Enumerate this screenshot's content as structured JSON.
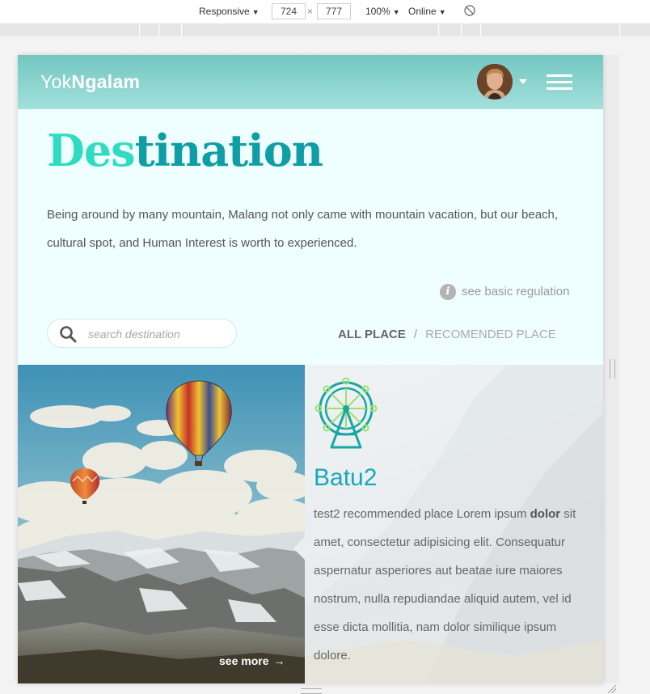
{
  "devtools": {
    "device": "Responsive",
    "width": "724",
    "height": "777",
    "zoom": "100%",
    "network": "Online",
    "times_sign": "×"
  },
  "header": {
    "logo_light": "Yok",
    "logo_bold": "Ngalam"
  },
  "intro": {
    "title_part1": "Des",
    "title_part2": "tination",
    "description": "Being around by many mountain, Malang not only came with mountain vacation, but our beach, cultural spot, and Human Interest is worth to experienced.",
    "regulation_link": "see basic regulation",
    "info_glyph": "i"
  },
  "search": {
    "placeholder": "search destination"
  },
  "filters": {
    "all": "ALL PLACE",
    "separator": "/",
    "recommended": "RECOMENDED PLACE"
  },
  "card": {
    "title": "Batu2",
    "desc_before": "test2 recommended place Lorem ipsum ",
    "desc_bold": "dolor",
    "desc_after": " sit amet, consectetur adipisicing elit. Consequatur aspernatur asperiores aut beatae iure maiores nostrum, nulla repudiandae aliquid autem, vel id esse dicta mollitia, nam dolor similique ipsum dolore.",
    "see_more": "see more",
    "arrow": "→"
  },
  "colors": {
    "header_top": "#73c7c1",
    "title_light": "#2fdcc2",
    "title_dark": "#0f9ea6",
    "card_title": "#1aa8b8",
    "icon_accent": "#16a7a5",
    "icon_green": "#9fe06b"
  }
}
